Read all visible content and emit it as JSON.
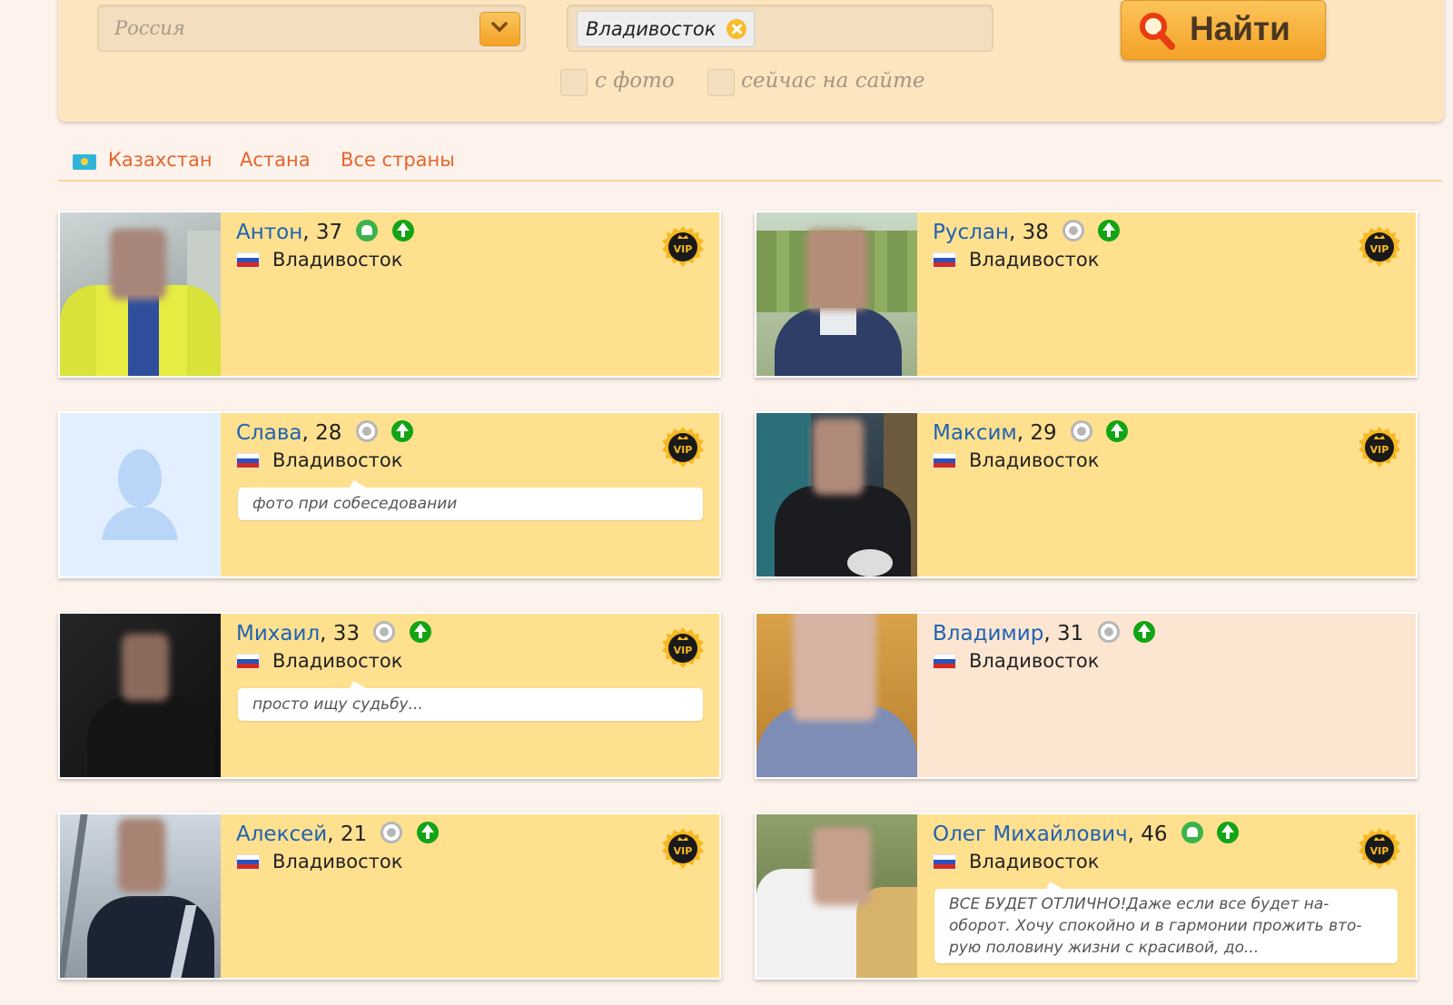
{
  "search": {
    "country_value": "Россия",
    "city_tag": "Владивосток",
    "checkbox_photo_label": "с фото",
    "checkbox_online_label": "сейчас на сайте",
    "find_label": "Найти"
  },
  "locations": {
    "country": "Казахстан",
    "city": "Астана",
    "all": "Все страны"
  },
  "profiles": [
    {
      "name": "Антон",
      "age": ", 37",
      "city": "Владивосток",
      "status": "android",
      "vip": true,
      "note": ""
    },
    {
      "name": "Руслан",
      "age": ", 38",
      "city": "Владивосток",
      "status": "offline",
      "vip": true,
      "note": ""
    },
    {
      "name": "Слава",
      "age": ", 28",
      "city": "Владивосток",
      "status": "offline",
      "vip": true,
      "note": "фото при собеседовании"
    },
    {
      "name": "Максим",
      "age": ", 29",
      "city": "Владивосток",
      "status": "offline",
      "vip": true,
      "note": ""
    },
    {
      "name": "Михаил",
      "age": ", 33",
      "city": "Владивосток",
      "status": "offline",
      "vip": true,
      "note": "просто ищу судьбу..."
    },
    {
      "name": "Владимир",
      "age": ", 31",
      "city": "Владивосток",
      "status": "offline",
      "vip": false,
      "note": ""
    },
    {
      "name": "Алексей",
      "age": ", 21",
      "city": "Владивосток",
      "status": "offline",
      "vip": true,
      "note": ""
    },
    {
      "name": "Олег Михайлович",
      "age": ", 46",
      "city": "Владивосток",
      "status": "android",
      "vip": true,
      "note": "ВСЕ БУДЕТ ОТЛИЧНО!Даже если все будет на-оборот. Хочу спокойно и в гармонии прожить вто-рую половину жизни с красивой, до..."
    }
  ],
  "vip_badge_text": "VIP",
  "colors": {
    "accent_orange": "#e6652b",
    "name_blue": "#1f63b3",
    "card_vip_bg": "#ffe08f",
    "card_plain_bg": "#fde6d1",
    "online_green": "#13a415"
  }
}
